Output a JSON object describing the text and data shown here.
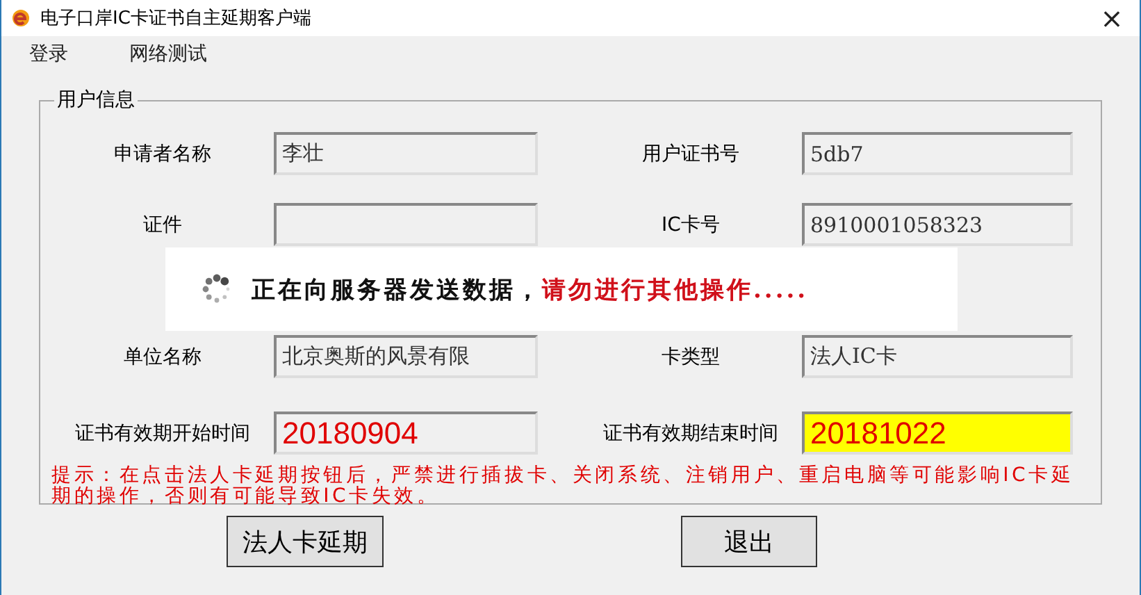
{
  "window": {
    "title": "电子口岸IC卡证书自主延期客户端",
    "close": "×"
  },
  "menu": [
    {
      "label": "登录"
    },
    {
      "label": "网络测试"
    }
  ],
  "group": {
    "title": "用户信息",
    "fields": [
      {
        "label": "申请者名称",
        "value": "李壮",
        "kind": "text",
        "highlighted": false
      },
      {
        "label": "用户证书号",
        "value": "5db7",
        "kind": "text",
        "highlighted": false
      },
      {
        "label": "证件",
        "kind": "text",
        "highlighted": false
      },
      {
        "label": "IC卡号",
        "value": "8910001058323",
        "kind": "text",
        "highlighted": false
      },
      {
        "label": "单位名称",
        "value": "北京奥斯的风景有限",
        "kind": "text",
        "highlighted": false
      },
      {
        "label": "卡类型",
        "value": "法人IC卡",
        "kind": "text",
        "highlighted": false
      },
      {
        "label": "证书有效期开始时间",
        "value": "20180904",
        "kind": "date",
        "highlighted": false
      },
      {
        "label": "证书有效期结束时间",
        "value": "20181022",
        "kind": "date",
        "highlighted": true
      }
    ],
    "hint": "提示：在点击法人卡延期按钮后，严禁进行插拔卡、关闭系统、注销用户、重启电脑等可能影响IC卡延期的操作，否则有可能导致IC卡失效。"
  },
  "buttons": [
    {
      "label": "法人卡延期"
    },
    {
      "label": "退出"
    }
  ],
  "overlay": {
    "message": "正在向服务器发送数据，",
    "warning": "请勿进行其他操作....."
  }
}
